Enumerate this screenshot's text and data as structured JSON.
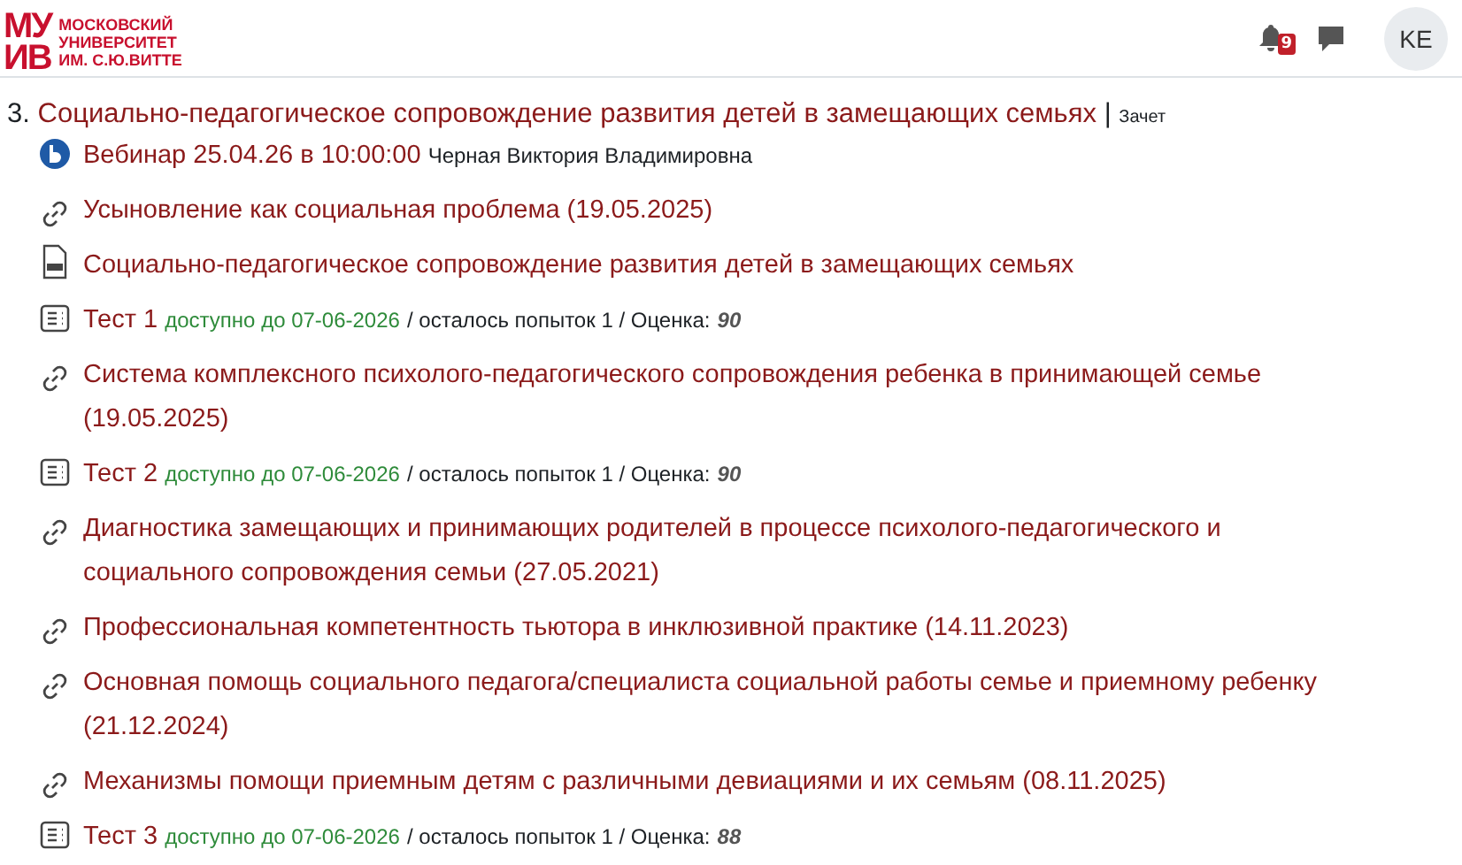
{
  "header": {
    "logo": {
      "mark_lines": [
        "МУ",
        "ИВ"
      ],
      "name_lines": [
        "МОСКОВСКИЙ",
        "УНИВЕРСИТЕТ",
        "ИМ. С.Ю.ВИТТЕ"
      ]
    },
    "notifications_count": "9",
    "avatar": "KE"
  },
  "section": {
    "number": "3.",
    "title": "Социально-педагогическое сопровождение развития детей в замещающих семьях",
    "separator": "|",
    "tag": "Зачет"
  },
  "items": [
    {
      "kind": "webinar",
      "title": "Вебинар 25.04.26 в 10:00:00",
      "author": "Черная Виктория Владимировна"
    },
    {
      "kind": "url",
      "title": "Усыновление как социальная проблема (19.05.2025)"
    },
    {
      "kind": "pdf",
      "title": "Социально-педагогическое сопровождение развития детей в замещающих семьях"
    },
    {
      "kind": "quiz",
      "title": "Тест 1",
      "available": "доступно до 07-06-2026",
      "attempts": "/ осталось попыток 1 / Оценка:",
      "grade": "90"
    },
    {
      "kind": "url",
      "title": "Система комплексного психолого-педагогического сопровождения ребенка в принимающей семье (19.05.2025)"
    },
    {
      "kind": "quiz",
      "title": "Тест 2",
      "available": "доступно до 07-06-2026",
      "attempts": "/ осталось попыток 1 / Оценка:",
      "grade": "90"
    },
    {
      "kind": "url",
      "title": "Диагностика замещающих и принимающих родителей в процессе психолого-педагогического и социального сопровождения семьи (27.05.2021)"
    },
    {
      "kind": "url",
      "title": "Профессиональная компетентность тьютора в инклюзивной практике (14.11.2023)"
    },
    {
      "kind": "url",
      "title": "Основная помощь социального педагога/специалиста социальной работы семье и приемному ребенку (21.12.2024)"
    },
    {
      "kind": "url",
      "title": "Механизмы помощи приемным детям с различными девиациями и их семьям (08.11.2025)"
    },
    {
      "kind": "quiz",
      "title": "Тест 3",
      "available": "доступно до 07-06-2026",
      "attempts": "/ осталось попыток 1 / Оценка:",
      "grade": "88"
    }
  ]
}
